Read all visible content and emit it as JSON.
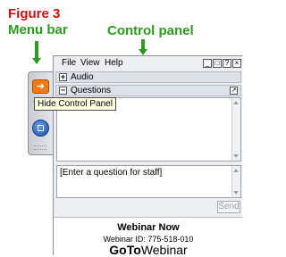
{
  "annotations": {
    "figure": "Figure 3",
    "menu_bar": "Menu bar",
    "control_panel": "Control panel"
  },
  "grabtab": {
    "collapse_icon": "arrow-right-icon",
    "webcam_icon": "screen-sharing-icon",
    "tooltip": "Hide Control Panel"
  },
  "menu": {
    "items": [
      "File",
      "View",
      "Help"
    ]
  },
  "window_controls": {
    "icons": [
      "minimize-icon",
      "restore-icon",
      "help-icon",
      "close-icon"
    ]
  },
  "audio": {
    "label": "Audio",
    "toggle": "+"
  },
  "questions": {
    "label": "Questions",
    "toggle": "−",
    "input_placeholder": "[Enter a question for staff]",
    "send_label": "Send"
  },
  "footer": {
    "title": "Webinar Now",
    "webinar_id": "Webinar ID: 775-518-010",
    "brand_bold": "GoTo",
    "brand_rest": "Webinar"
  },
  "colors": {
    "annotation_green": "#2e9a1f",
    "annotation_red": "#c81010",
    "collapse_orange": "#f07a14"
  }
}
